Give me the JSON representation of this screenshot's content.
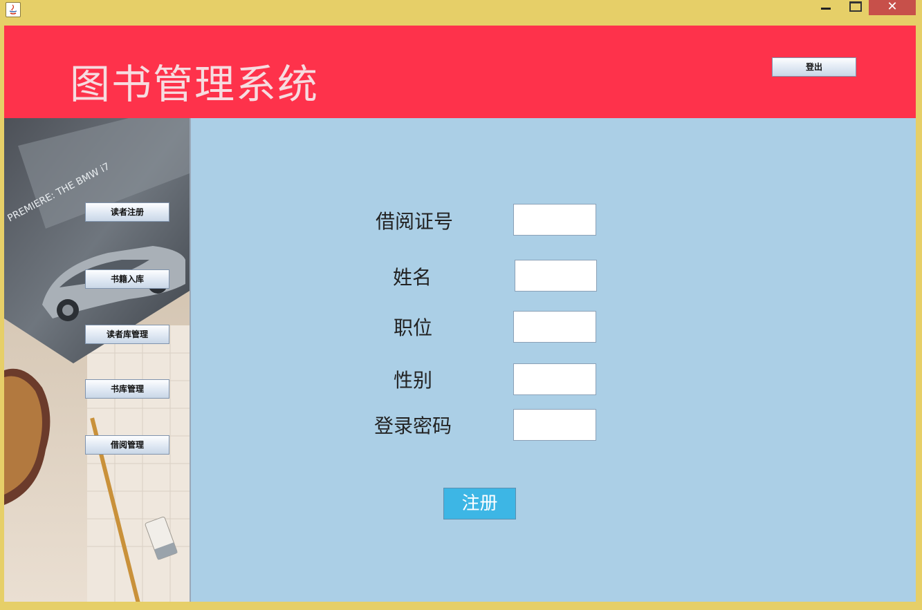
{
  "window": {
    "close_glyph": "✕"
  },
  "header": {
    "title": "图书管理系统",
    "logout_label": "登出"
  },
  "sidebar": {
    "items": [
      {
        "label": "读者注册"
      },
      {
        "label": "书籍入库"
      },
      {
        "label": "读者库管理"
      },
      {
        "label": "书库管理"
      },
      {
        "label": "借阅管理"
      }
    ],
    "background_text": "PREMIERE: THE BMW i7"
  },
  "form": {
    "fields": [
      {
        "label": "借阅证号",
        "value": ""
      },
      {
        "label": "姓名",
        "value": ""
      },
      {
        "label": "职位",
        "value": ""
      },
      {
        "label": "性别",
        "value": ""
      },
      {
        "label": "登录密码",
        "value": ""
      }
    ],
    "submit_label": "注册"
  },
  "colors": {
    "window_frame": "#e6cf68",
    "header_bg": "#fe324b",
    "content_bg": "#abcfe6",
    "register_button": "#3db6e5",
    "close_button": "#c7504a"
  }
}
